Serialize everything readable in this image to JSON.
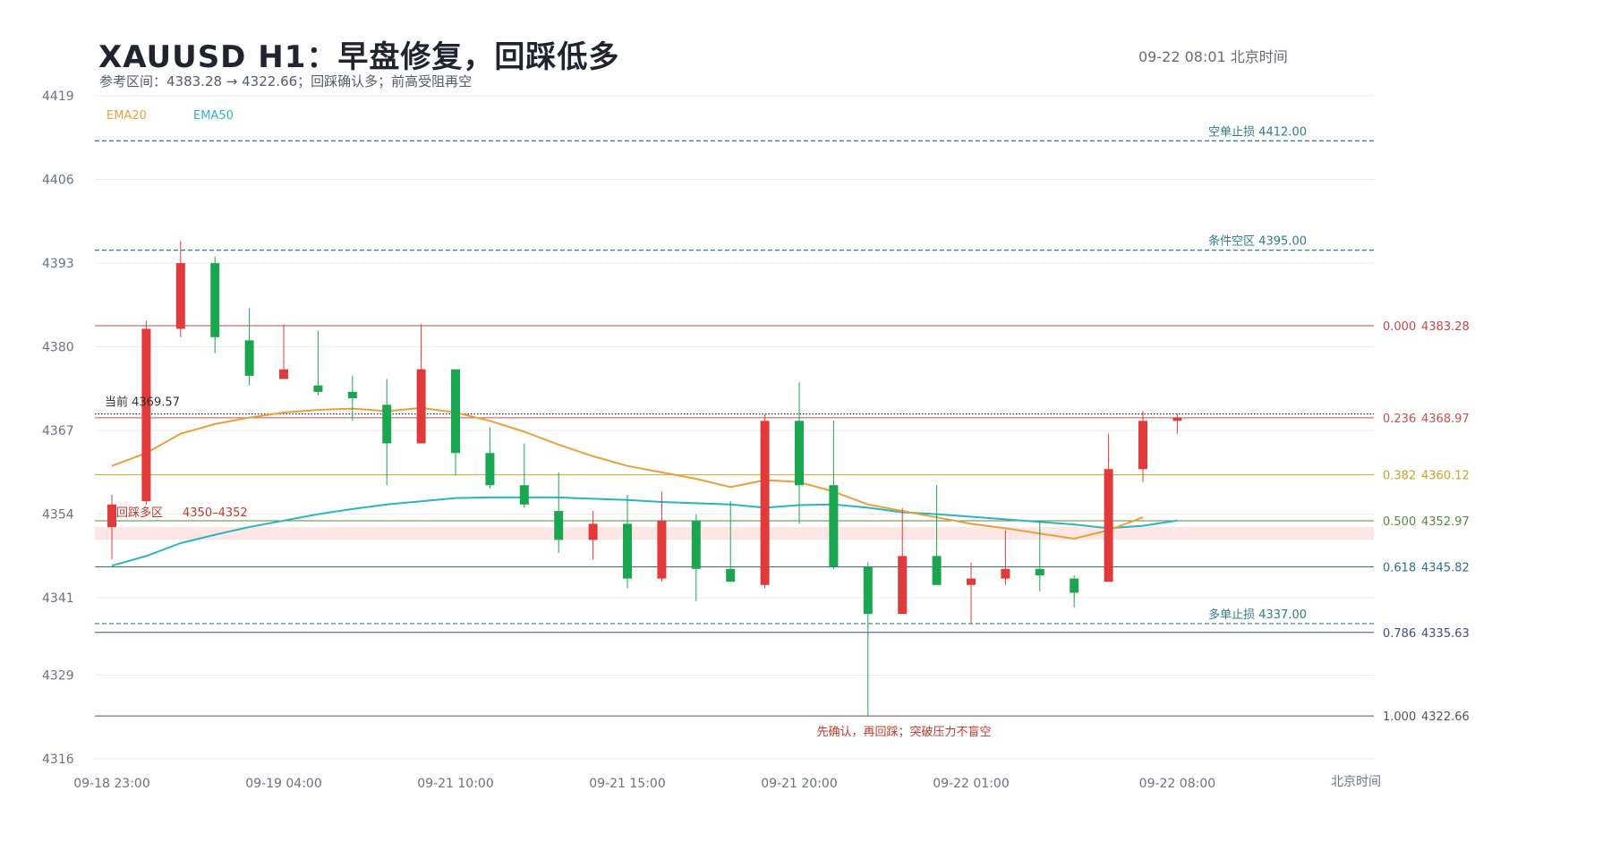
{
  "header": {
    "title": "XAUUSD  H1：早盘修复，回踩低多",
    "subtitle": "参考区间：4383.28 → 4322.66；回踩确认多；前高受阻再空",
    "timestamp": "09-22  08:01 北京时间"
  },
  "chart_data": {
    "type": "candlestick",
    "y_ticks": [
      4316,
      4329,
      4341,
      4354,
      4367,
      4380,
      4393,
      4406,
      4419
    ],
    "ylim": [
      4316,
      4419
    ],
    "x_tick_labels": [
      {
        "i": 0,
        "label": "09-18 23:00"
      },
      {
        "i": 5,
        "label": "09-19 04:00"
      },
      {
        "i": 10,
        "label": "09-21 10:00"
      },
      {
        "i": 15,
        "label": "09-21 15:00"
      },
      {
        "i": 20,
        "label": "09-21 20:00"
      },
      {
        "i": 25,
        "label": "09-22 01:00"
      },
      {
        "i": 31,
        "label": "09-22 08:00"
      }
    ],
    "x_axis_unit": "北京时间",
    "colors": {
      "up": "#e03a3a",
      "down": "#1aa64f",
      "ema20": "#e8a03c",
      "ema50": "#2cb5bc",
      "grid": "#ebebeb"
    },
    "candles": [
      {
        "o": 4352.0,
        "h": 4357.0,
        "l": 4347.0,
        "c": 4355.5
      },
      {
        "o": 4356.0,
        "h": 4384.0,
        "l": 4355.5,
        "c": 4382.8
      },
      {
        "o": 4382.8,
        "h": 4396.5,
        "l": 4381.5,
        "c": 4393.0
      },
      {
        "o": 4393.0,
        "h": 4394.0,
        "l": 4379.0,
        "c": 4381.5
      },
      {
        "o": 4381.0,
        "h": 4386.0,
        "l": 4374.0,
        "c": 4375.5
      },
      {
        "o": 4375.0,
        "h": 4383.5,
        "l": 4375.0,
        "c": 4376.5
      },
      {
        "o": 4374.0,
        "h": 4382.5,
        "l": 4372.5,
        "c": 4373.0
      },
      {
        "o": 4373.0,
        "h": 4375.5,
        "l": 4368.5,
        "c": 4372.0
      },
      {
        "o": 4371.0,
        "h": 4375.0,
        "l": 4358.5,
        "c": 4365.0
      },
      {
        "o": 4365.0,
        "h": 4383.5,
        "l": 4365.0,
        "c": 4376.5
      },
      {
        "o": 4376.5,
        "h": 4376.5,
        "l": 4360.0,
        "c": 4363.5
      },
      {
        "o": 4363.5,
        "h": 4367.5,
        "l": 4358.0,
        "c": 4358.5
      },
      {
        "o": 4358.5,
        "h": 4365.0,
        "l": 4355.0,
        "c": 4355.5
      },
      {
        "o": 4354.5,
        "h": 4360.5,
        "l": 4348.0,
        "c": 4350.0
      },
      {
        "o": 4350.0,
        "h": 4354.5,
        "l": 4347.0,
        "c": 4352.5
      },
      {
        "o": 4352.5,
        "h": 4357.0,
        "l": 4342.5,
        "c": 4344.0
      },
      {
        "o": 4344.0,
        "h": 4357.5,
        "l": 4343.5,
        "c": 4353.0
      },
      {
        "o": 4353.0,
        "h": 4354.0,
        "l": 4340.5,
        "c": 4345.5
      },
      {
        "o": 4345.5,
        "h": 4356.0,
        "l": 4343.5,
        "c": 4343.5
      },
      {
        "o": 4343.0,
        "h": 4369.5,
        "l": 4342.5,
        "c": 4368.5
      },
      {
        "o": 4368.5,
        "h": 4374.5,
        "l": 4352.5,
        "c": 4358.5
      },
      {
        "o": 4358.5,
        "h": 4368.5,
        "l": 4345.5,
        "c": 4345.8
      },
      {
        "o": 4345.8,
        "h": 4346.5,
        "l": 4322.66,
        "c": 4338.5
      },
      {
        "o": 4338.5,
        "h": 4355.0,
        "l": 4338.5,
        "c": 4347.5
      },
      {
        "o": 4347.5,
        "h": 4358.5,
        "l": 4343.0,
        "c": 4343.0
      },
      {
        "o": 4343.0,
        "h": 4346.5,
        "l": 4337.0,
        "c": 4344.0
      },
      {
        "o": 4344.0,
        "h": 4351.5,
        "l": 4343.0,
        "c": 4345.5
      },
      {
        "o": 4345.5,
        "h": 4353.0,
        "l": 4342.0,
        "c": 4344.5
      },
      {
        "o": 4344.0,
        "h": 4344.5,
        "l": 4339.5,
        "c": 4341.8
      },
      {
        "o": 4343.5,
        "h": 4366.5,
        "l": 4343.5,
        "c": 4361.0
      },
      {
        "o": 4361.0,
        "h": 4370.0,
        "l": 4359.0,
        "c": 4368.5
      },
      {
        "o": 4368.5,
        "h": 4369.6,
        "l": 4366.5,
        "c": 4369.0
      }
    ],
    "ema20": [
      4361.5,
      4363.5,
      4366.5,
      4368.0,
      4369.0,
      4369.8,
      4370.2,
      4370.4,
      4370.0,
      4370.5,
      4369.8,
      4368.5,
      4366.8,
      4364.8,
      4363.0,
      4361.5,
      4360.5,
      4359.5,
      4358.2,
      4359.3,
      4359.0,
      4357.5,
      4355.5,
      4354.5,
      4353.5,
      4352.5,
      4351.8,
      4351.0,
      4350.2,
      4351.5,
      4353.5
    ],
    "ema50": [
      4346.0,
      4347.5,
      4349.5,
      4350.8,
      4352.0,
      4353.0,
      4354.0,
      4354.8,
      4355.5,
      4356.0,
      4356.5,
      4356.6,
      4356.6,
      4356.6,
      4356.4,
      4356.2,
      4355.9,
      4355.7,
      4355.5,
      4355.0,
      4355.4,
      4355.5,
      4355.0,
      4354.3,
      4354.0,
      4353.6,
      4353.2,
      4352.8,
      4352.4,
      4351.8,
      4352.2,
      4353.0
    ],
    "hlines": [
      {
        "label": "空单止损 4412.00",
        "value": 4412.0,
        "color": "#2f7d8c",
        "style": "dashed",
        "side": "inner"
      },
      {
        "label": "条件空区 4395.00",
        "value": 4395.0,
        "color": "#2f7d8c",
        "style": "dashed",
        "side": "inner"
      },
      {
        "label": "多单止损 4337.00",
        "value": 4337.0,
        "color": "#2f7d8c",
        "style": "dashed",
        "side": "inner"
      },
      {
        "label": "当前 4369.57",
        "value": 4369.57,
        "color": "#333333",
        "style": "dotted",
        "side": "left"
      }
    ],
    "fib_levels": [
      {
        "ratio": "0.000",
        "value": 4383.28,
        "color": "#cc4444"
      },
      {
        "ratio": "0.236",
        "value": 4368.97,
        "color": "#c0524a"
      },
      {
        "ratio": "0.382",
        "value": 4360.12,
        "color": "#c9a227"
      },
      {
        "ratio": "0.500",
        "value": 4352.97,
        "color": "#5a8a3a"
      },
      {
        "ratio": "0.618",
        "value": 4345.82,
        "color": "#2f6e86"
      },
      {
        "ratio": "0.786",
        "value": 4335.63,
        "color": "#3c4d8c"
      },
      {
        "ratio": "1.000",
        "value": 4322.66,
        "color": "#555555"
      }
    ],
    "zone": {
      "label": "回踩多区",
      "range_label": "4350–4352",
      "from": 4350,
      "to": 4352,
      "color": "#fde6e6",
      "text_color": "#c0392b"
    },
    "annotation": {
      "text": "先确认，再回踩；突破压力不盲空",
      "color": "#c0392b",
      "at_value": 4322.66
    },
    "legend": [
      {
        "name": "EMA20",
        "color": "#e8a03c"
      },
      {
        "name": "EMA50",
        "color": "#2cb5bc"
      }
    ]
  }
}
